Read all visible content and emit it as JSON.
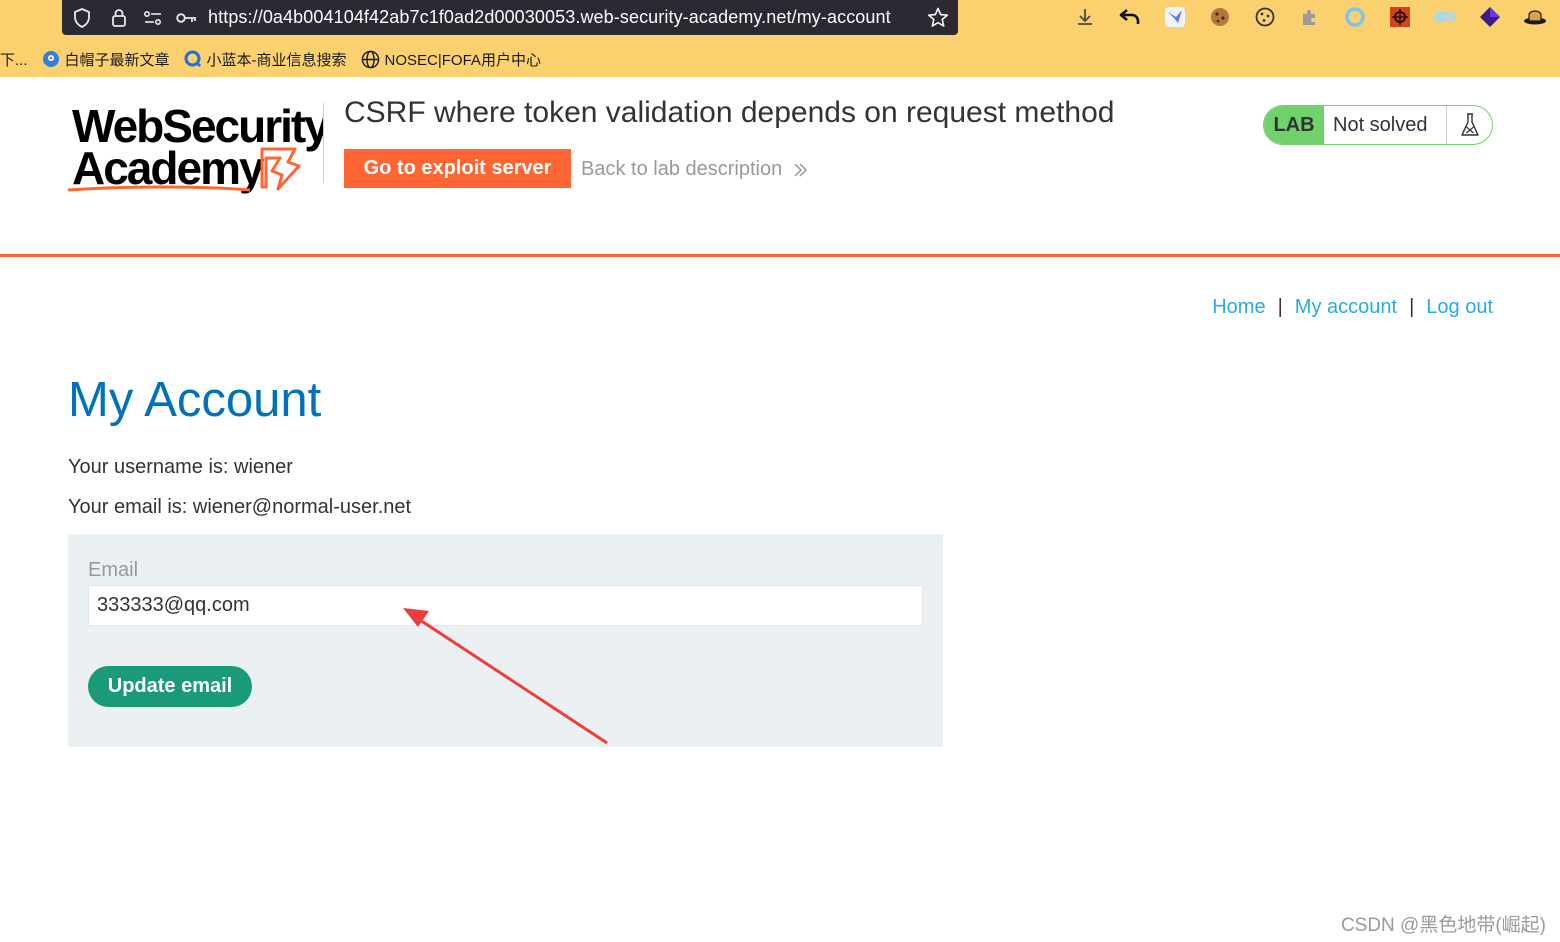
{
  "browser": {
    "url_host": "https://0a4b004104f42ab7c1f0ad2d00030053.",
    "url_domain": "web-security-academy.net",
    "url_path": "/my-account",
    "bookmarks": [
      {
        "label": "下..."
      },
      {
        "label": "白帽子最新文章"
      },
      {
        "label": "小蓝本-商业信息搜索"
      },
      {
        "label": "NOSEC|FOFA用户中心"
      }
    ]
  },
  "header": {
    "logo_line1": "WebSecurity",
    "logo_line2": "Academy",
    "lab_title": "CSRF where token validation depends on request method",
    "exploit_button": "Go to exploit server",
    "back_link": "Back to lab description",
    "lab_badge": "LAB",
    "lab_status": "Not solved"
  },
  "nav": {
    "home": "Home",
    "separator": "|",
    "my_account": "My account",
    "log_out": "Log out"
  },
  "main": {
    "title": "My Account",
    "username_line": "Your username is: wiener",
    "email_line": "Your email is: wiener@normal-user.net",
    "form": {
      "email_label": "Email",
      "email_value": "333333@qq.com",
      "update_button": "Update email"
    }
  },
  "colors": {
    "accent_orange": "#ff6633",
    "link_blue": "#29abe2",
    "title_blue": "#0071bc",
    "button_green": "#1a9a78",
    "lab_green": "#70d16d",
    "annotation_red": "#f03c3c"
  },
  "watermark": "CSDN @黑色地带(崛起)"
}
